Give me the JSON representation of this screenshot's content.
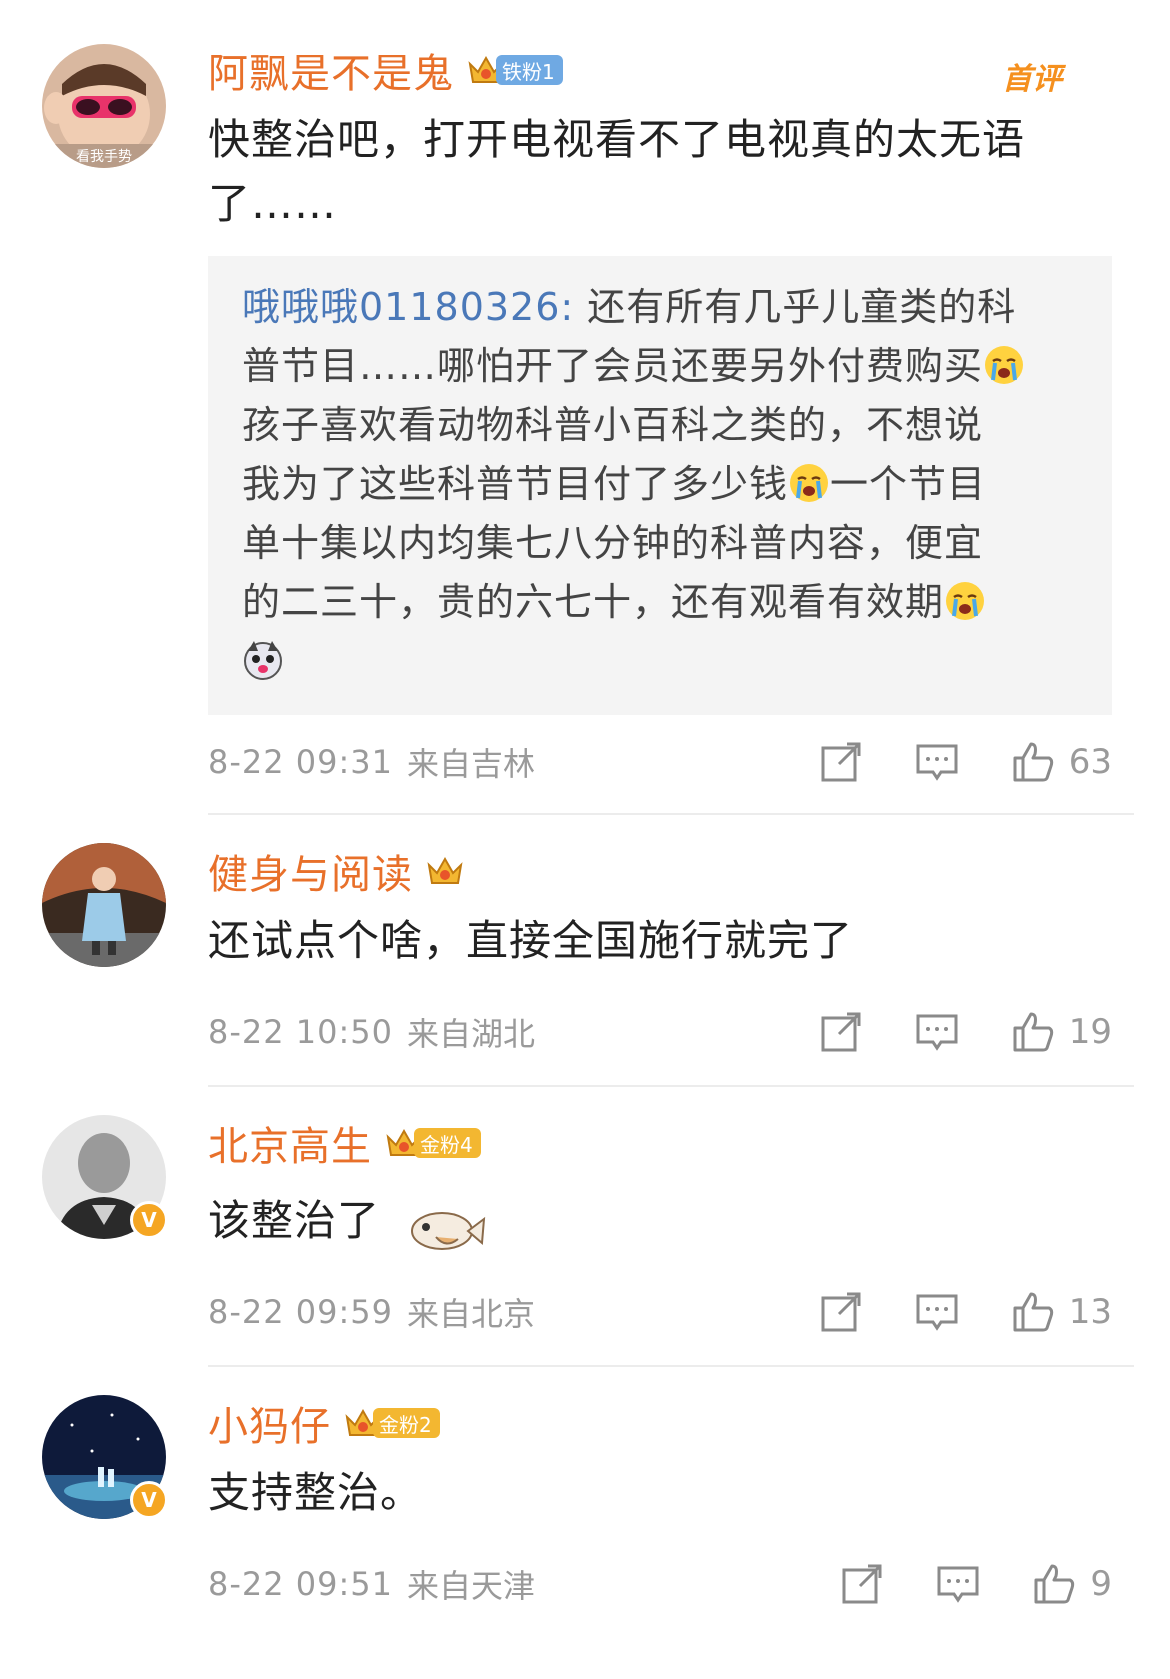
{
  "comments": [
    {
      "username": "阿飘是不是鬼",
      "fan_badge": "铁粉1",
      "fan_type": "iron",
      "hot_label": "首评",
      "text_line1": "快整治吧，打开电视看不了电视真的太无语",
      "text_line2": "了……",
      "avatar_caption": "看我手势",
      "reply": {
        "author": "哦哦哦01180326:",
        "line1": " 还有所有几乎儿童类的科",
        "line2": "普节目……哪怕开了会员还要另外付费购买",
        "line3": "孩子喜欢看动物科普小百科之类的，不想说",
        "line4a": "我为了这些科普节目付了多少钱",
        "line4b": "一个节目",
        "line5": "单十集以内均集七八分钟的科普内容，便宜",
        "line6": "的二三十，贵的六七十，还有观看有效期"
      },
      "time": "8-22 09:31",
      "location": "来自吉林",
      "likes": "63"
    },
    {
      "username": "健身与阅读",
      "text": "还试点个啥，直接全国施行就完了",
      "time": "8-22 10:50",
      "location": "来自湖北",
      "likes": "19"
    },
    {
      "username": "北京高生",
      "fan_badge": "金粉4",
      "fan_type": "gold",
      "verified": "V",
      "text": "该整治了",
      "time": "8-22 09:59",
      "location": "来自北京",
      "likes": "13"
    },
    {
      "username": "小犸仔",
      "fan_badge": "金粉2",
      "fan_type": "gold",
      "verified": "V",
      "text": "支持整治。",
      "time": "8-22 09:51",
      "location": "来自天津",
      "likes": "9"
    }
  ],
  "colors": {
    "username": "#e8702a",
    "reply_author": "#4a78b8",
    "meta": "#9a9a9a",
    "hot_label": "#f5901e"
  },
  "icons": [
    "share-icon",
    "comment-icon",
    "like-icon",
    "crying-emoji",
    "dog-emoji",
    "fish-sticker",
    "crown-icon",
    "verified-icon"
  ]
}
